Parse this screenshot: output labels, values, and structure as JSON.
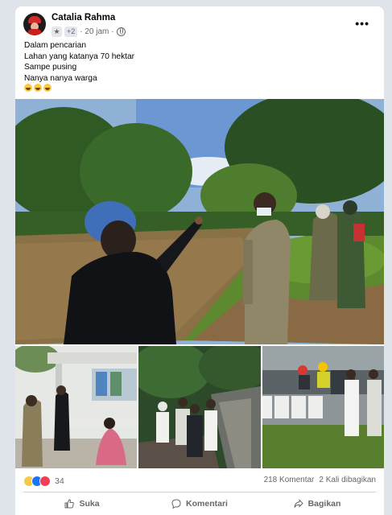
{
  "post": {
    "author_name": "Catalia Rahma",
    "badge_plus": "+2",
    "time": "· 20 jam ·",
    "more_label": "•••",
    "text_lines": [
      "Dalam pencarian",
      "Lahan yang katanya 70 hektar",
      "Sampe pusing",
      "Nanya nanya warga"
    ],
    "emoji_line": [
      "laughing-emoji",
      "laughing-emoji",
      "laughing-emoji"
    ]
  },
  "stats": {
    "reactions": [
      "haha",
      "like",
      "love"
    ],
    "reaction_count": "34",
    "comments": "218 Komentar",
    "shares": "2 Kali dibagikan"
  },
  "actions": {
    "like": "Suka",
    "comment": "Komentari",
    "share": "Bagikan"
  },
  "icons": {
    "like": "thumbs-up-icon",
    "comment": "speech-bubble-icon",
    "share": "share-arrow-icon",
    "privacy": "globe-icon",
    "badge": "star-icon"
  },
  "colors": {
    "muted": "#65676b",
    "like_blue": "#1877f2",
    "love_red": "#f33e58",
    "haha_yellow": "#f7c948"
  }
}
